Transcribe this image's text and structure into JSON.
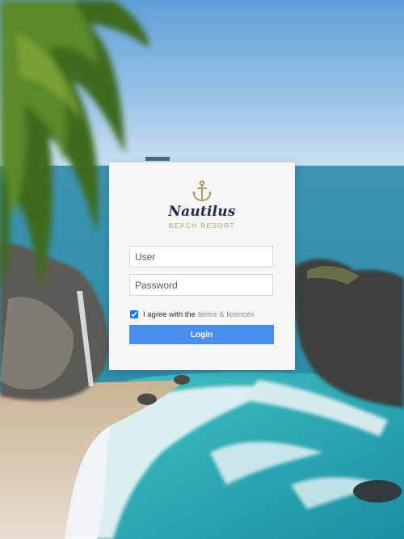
{
  "brand": {
    "name": "Nautilus",
    "tagline": "BEACH RESORT",
    "icon": "anchor-icon"
  },
  "form": {
    "user_placeholder": "User",
    "password_placeholder": "Password",
    "agree_text": "I agree with the",
    "agree_link": "terms & licences",
    "agree_checked": true,
    "login_label": "Login"
  },
  "colors": {
    "accent": "#4a8ef0",
    "brand_navy": "#1d2a4a",
    "brand_gold": "#b59a63"
  }
}
